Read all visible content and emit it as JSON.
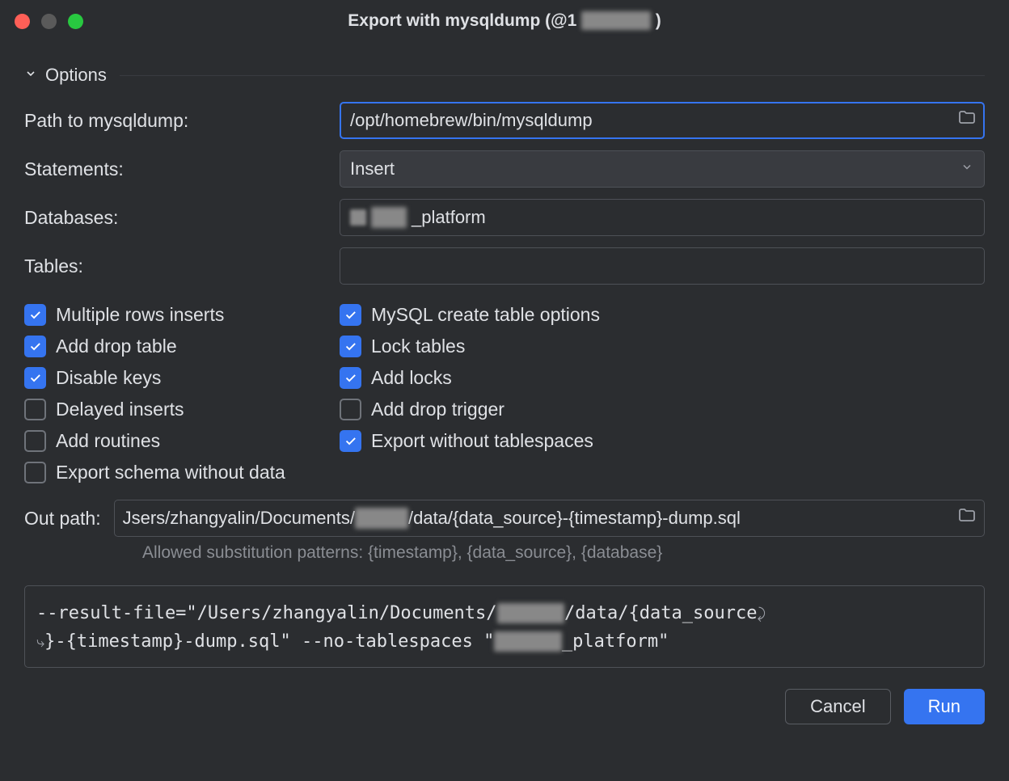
{
  "title": {
    "prefix": "Export with mysqldump (@1",
    "blurred": "xxxxxxx",
    "suffix": ")"
  },
  "section": {
    "options": "Options"
  },
  "labels": {
    "path": "Path to mysqldump:",
    "statements": "Statements:",
    "databases": "Databases:",
    "tables": "Tables:",
    "outpath": "Out path:"
  },
  "fields": {
    "path_value": "/opt/homebrew/bin/mysqldump",
    "statements_value": "Insert",
    "databases_prefix_blur": "xxxx",
    "databases_suffix": "_platform",
    "tables_value": "",
    "outpath_value_pre": "Jsers/zhangyalin/Documents/",
    "outpath_value_blur": "xxxxxx",
    "outpath_value_post": "/data/{data_source}-{timestamp}-dump.sql"
  },
  "checks": {
    "left": [
      {
        "id": "multiple_rows",
        "label": "Multiple rows inserts",
        "checked": true
      },
      {
        "id": "add_drop_table",
        "label": "Add drop table",
        "checked": true
      },
      {
        "id": "disable_keys",
        "label": "Disable keys",
        "checked": true
      },
      {
        "id": "delayed_inserts",
        "label": "Delayed inserts",
        "checked": false
      },
      {
        "id": "add_routines",
        "label": "Add routines",
        "checked": false
      },
      {
        "id": "export_schema",
        "label": "Export schema without data",
        "checked": false
      }
    ],
    "right": [
      {
        "id": "mysql_create_opts",
        "label": "MySQL create table options",
        "checked": true
      },
      {
        "id": "lock_tables",
        "label": "Lock tables",
        "checked": true
      },
      {
        "id": "add_locks",
        "label": "Add locks",
        "checked": true
      },
      {
        "id": "add_drop_trigger",
        "label": "Add drop trigger",
        "checked": false
      },
      {
        "id": "export_no_tablespaces",
        "label": "Export without tablespaces",
        "checked": true
      }
    ]
  },
  "hint": "Allowed substitution patterns: {timestamp}, {data_source}, {database}",
  "preview": {
    "p1": "--result-file=\"/Users/zhangyalin/Documents/",
    "p1_blur": "xxxxxx",
    "p2": "/data/{data_source",
    "p3": "}-{timestamp}-dump.sql\" --no-tablespaces \"",
    "p3_blur": "xxxxxx",
    "p4": "_platform\""
  },
  "buttons": {
    "cancel": "Cancel",
    "run": "Run"
  }
}
